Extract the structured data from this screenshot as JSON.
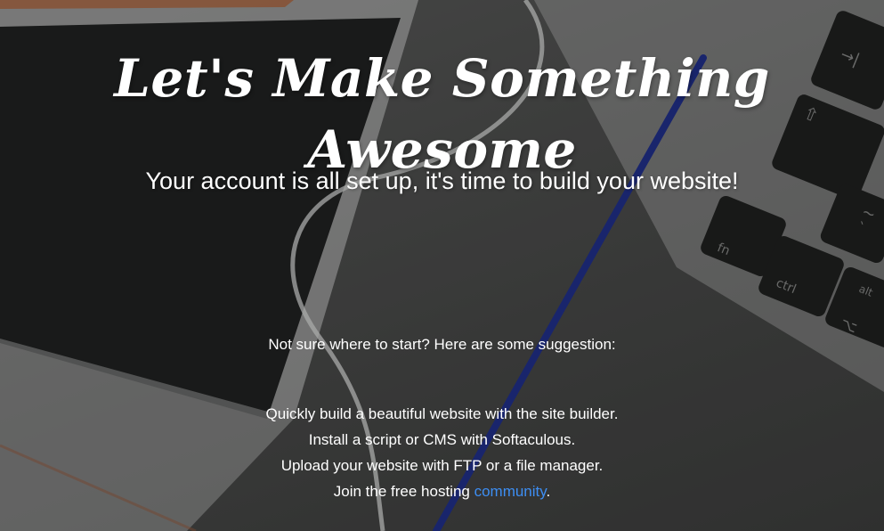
{
  "hero": {
    "headline": "Let's Make Something Awesome",
    "subtitle": "Your account is all set up, it's time to build your website!"
  },
  "suggestions": {
    "intro": "Not sure where to start? Here are some suggestion:",
    "items": [
      "Quickly build a beautiful website with the site builder.",
      "Install a script or CMS with Softaculous.",
      "Upload your website with FTP or a file manager."
    ],
    "community": {
      "prefix": "Join the free hosting ",
      "link_text": "community",
      "suffix": "."
    }
  },
  "keyboard": {
    "keys": [
      "→|",
      "⇧",
      "~",
      "`",
      "fn",
      "ctrl",
      "alt",
      "⌥"
    ]
  },
  "colors": {
    "link": "#3d8ef3",
    "text": "#ffffff"
  }
}
